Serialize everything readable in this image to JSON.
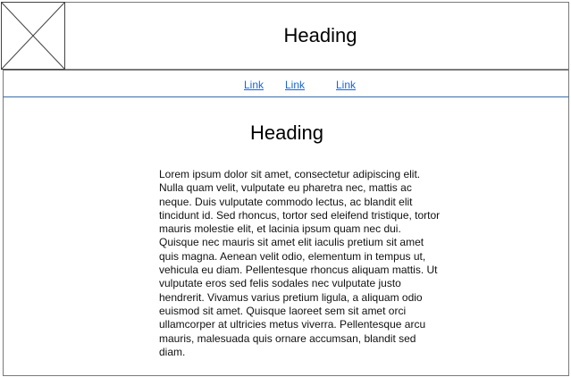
{
  "header": {
    "title": "Heading",
    "logo_icon": "image-placeholder-icon"
  },
  "nav": {
    "links": [
      {
        "label": "Link"
      },
      {
        "label": "Link"
      },
      {
        "label": "Link"
      }
    ]
  },
  "main": {
    "title": "Heading",
    "body": "Lorem ipsum dolor sit amet, consectetur adipiscing elit. Nulla quam velit, vulputate eu pharetra nec, mattis ac neque. Duis vulputate commodo lectus, ac blandit elit tincidunt id. Sed rhoncus, tortor sed eleifend tristique, tortor mauris molestie elit, et lacinia ipsum quam nec dui. Quisque nec mauris sit amet elit iaculis pretium sit amet quis magna. Aenean velit odio, elementum in tempus ut, vehicula eu diam. Pellentesque rhoncus aliquam mattis. Ut vulputate eros sed felis sodales nec vulputate justo hendrerit. Vivamus varius pretium ligula, a aliquam odio euismod sit amet. Quisque laoreet sem sit amet orci ullamcorper at ultricies metus viverra. Pellentesque arcu mauris, malesuada quis ornare accumsan, blandit sed diam."
  },
  "colors": {
    "link": "#1f63c6",
    "nav_divider": "#2f6fb4",
    "border": "#7a7a7a"
  }
}
